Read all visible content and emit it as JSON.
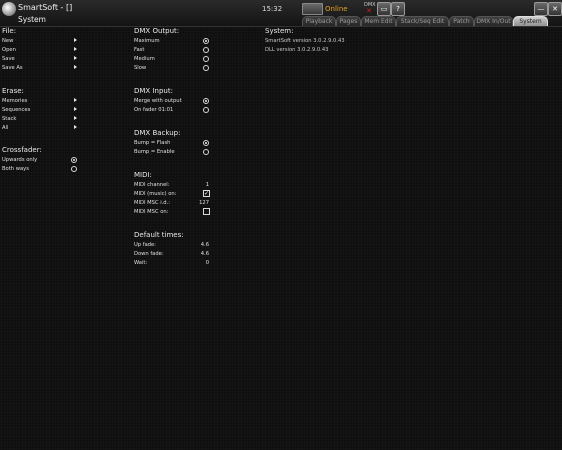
{
  "titlebar": {
    "app_title": "SmartSoft - []",
    "section": "System",
    "time": "15:32",
    "connection_status": "Online",
    "chip_label": "DMX",
    "help_label": "?",
    "minimize_label": "—",
    "close_label": "✕",
    "accent_color": "#e0a020"
  },
  "tabs": [
    {
      "label": "Playback",
      "active": false
    },
    {
      "label": "Pages",
      "active": false
    },
    {
      "label": "Mem Edit",
      "active": false
    },
    {
      "label": "Stack/Seq Edit",
      "active": false
    },
    {
      "label": "Patch",
      "active": false
    },
    {
      "label": "DMX In/Out",
      "active": false
    },
    {
      "label": "System",
      "active": true
    }
  ],
  "file": {
    "title": "File:",
    "items": [
      "New",
      "Open",
      "Save",
      "Save As"
    ]
  },
  "erase": {
    "title": "Erase:",
    "items": [
      "Memories",
      "Sequences",
      "Stack",
      "All"
    ]
  },
  "crossfader": {
    "title": "Crossfader:",
    "options": [
      {
        "label": "Upwards only",
        "selected": true
      },
      {
        "label": "Both ways",
        "selected": false
      }
    ]
  },
  "dmx_output": {
    "title": "DMX Output:",
    "options": [
      {
        "label": "Maximum",
        "selected": true
      },
      {
        "label": "Fast",
        "selected": false
      },
      {
        "label": "Medium",
        "selected": false
      },
      {
        "label": "Slow",
        "selected": false
      }
    ]
  },
  "dmx_input": {
    "title": "DMX Input:",
    "options": [
      {
        "label": "Merge with output",
        "selected": true
      },
      {
        "label": "On fader 01:01",
        "selected": false
      }
    ]
  },
  "dmx_backup": {
    "title": "DMX Backup:",
    "options": [
      {
        "label": "Bump = Flash",
        "selected": true
      },
      {
        "label": "Bump = Enable",
        "selected": false
      }
    ]
  },
  "midi": {
    "title": "MIDI:",
    "channel_label": "MIDI channel:",
    "channel_value": "1",
    "music_label": "MIDI (music) on:",
    "music_on": true,
    "msc_id_label": "MIDI MSC i.d.:",
    "msc_id_value": "127",
    "msc_on_label": "MIDI MSC on:",
    "msc_on": false
  },
  "default_times": {
    "title": "Default times:",
    "rows": [
      {
        "label": "Up fade:",
        "value": "4.6"
      },
      {
        "label": "Down fade:",
        "value": "4.6"
      },
      {
        "label": "Wait:",
        "value": "0"
      }
    ]
  },
  "system": {
    "title": "System:",
    "smartsoft_version": "SmartSoft version 3.0.2.9.0.43",
    "dll_version": "DLL version 3.0.2.9.0.43"
  }
}
